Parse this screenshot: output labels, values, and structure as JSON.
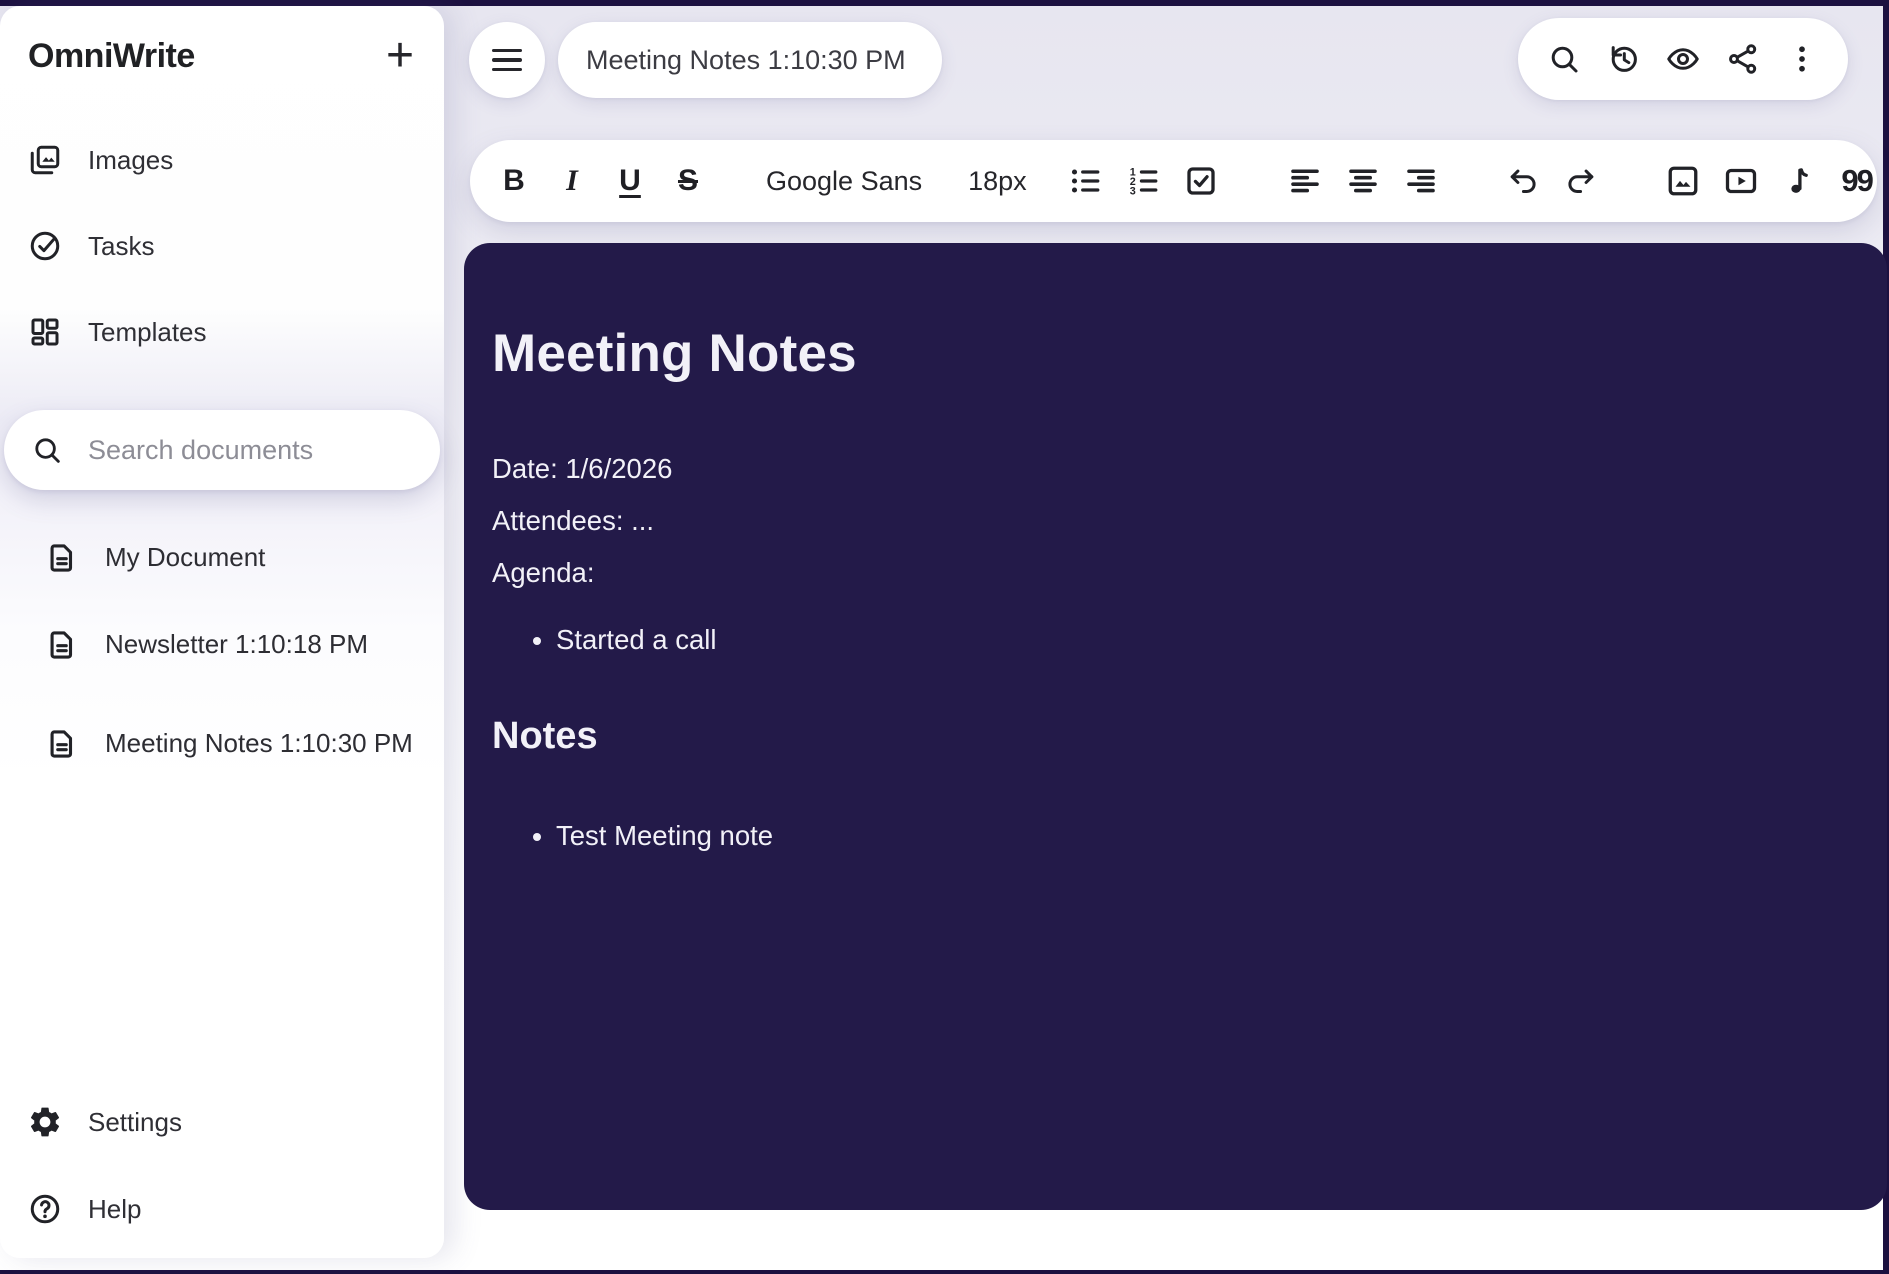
{
  "app": {
    "name": "OmniWrite"
  },
  "colors": {
    "editor_background": "#231a49",
    "window_edge": "#1c1140",
    "surface": "#ffffff",
    "icon": "#212227",
    "text_primary": "#26262b",
    "text_on_dark": "#f2f1f8",
    "placeholder": "#8d8d96"
  },
  "sidebar": {
    "new_doc_label": "+",
    "nav": [
      {
        "label": "Images",
        "icon": "images-icon"
      },
      {
        "label": "Tasks",
        "icon": "tasks-icon"
      },
      {
        "label": "Templates",
        "icon": "templates-icon"
      }
    ],
    "search": {
      "placeholder": "Search documents",
      "icon": "search-icon"
    },
    "documents": [
      {
        "title": "My Document",
        "icon": "document-icon"
      },
      {
        "title": "Newsletter 1:10:18 PM",
        "icon": "document-icon"
      },
      {
        "title": "Meeting Notes 1:10:30 PM",
        "icon": "document-icon"
      }
    ],
    "footer": [
      {
        "label": "Settings",
        "icon": "settings-gear-icon"
      },
      {
        "label": "Help",
        "icon": "help-icon"
      }
    ]
  },
  "topbar": {
    "menu_icon": "hamburger-icon",
    "title_value": "Meeting Notes 1:10:30 PM",
    "action_icons": [
      "search-icon",
      "history-icon",
      "preview-eye-icon",
      "share-icon",
      "more-vert-icon"
    ]
  },
  "toolbar": {
    "bold_label": "B",
    "italic_label": "I",
    "underline_label": "U",
    "strikethrough_label": "S",
    "font_name": "Google Sans",
    "font_size": "18px",
    "quote_label": "99"
  },
  "editor": {
    "heading": "Meeting Notes",
    "meta_lines": [
      "Date: 1/6/2026",
      "Attendees: ...",
      "Agenda:"
    ],
    "agenda_items": [
      "Started a call"
    ],
    "subheading": "Notes",
    "notes_items": [
      "Test Meeting note"
    ]
  }
}
